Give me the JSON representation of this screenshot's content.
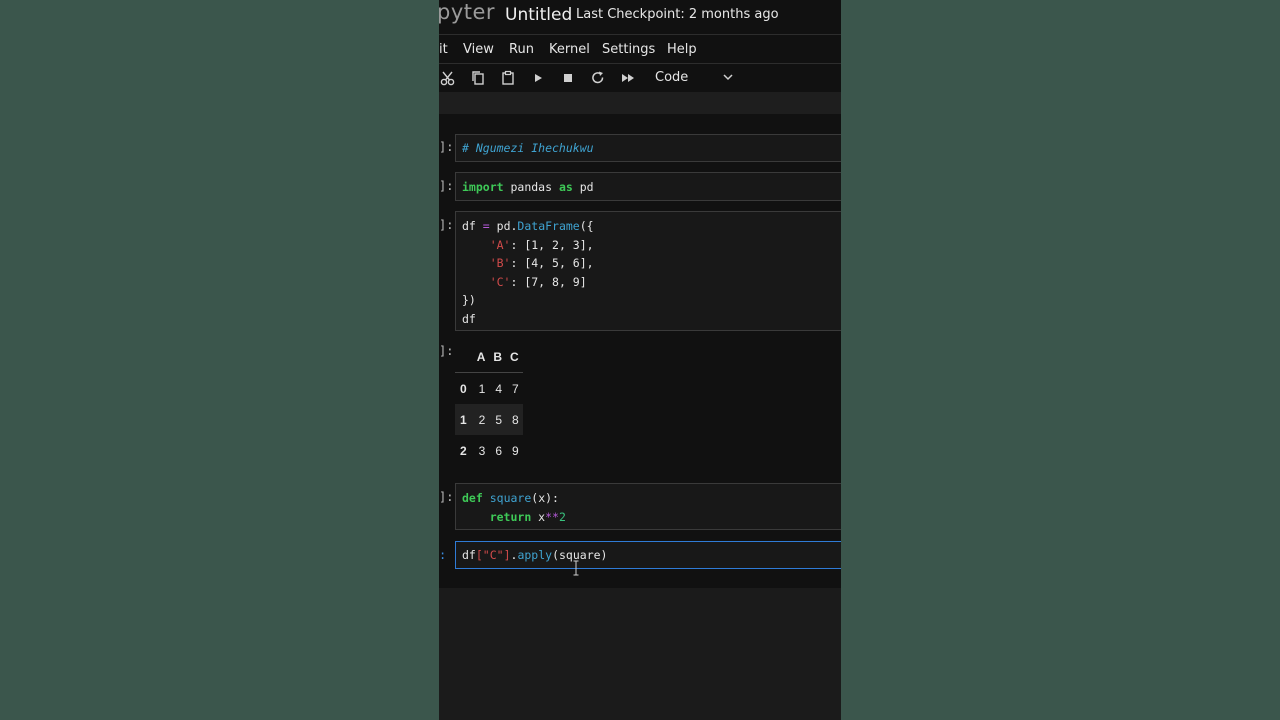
{
  "header": {
    "logo_partial": "pyter",
    "title": "Untitled",
    "checkpoint": "Last Checkpoint: 2 months ago"
  },
  "menu": [
    "it",
    "View",
    "Run",
    "Kernel",
    "Settings",
    "Help"
  ],
  "toolbar": {
    "icons": [
      "cut-icon",
      "copy-icon",
      "paste-icon",
      "run-icon",
      "stop-icon",
      "restart-icon",
      "fast-forward-icon"
    ],
    "cell_type": "Code"
  },
  "cells": {
    "c1": {
      "prompt": "]:",
      "line1": "# Ngumezi Ihechukwu"
    },
    "c2": {
      "prompt": "]:"
    },
    "c3": {
      "prompt": "]:"
    },
    "c3_output": {
      "prompt": "]:"
    },
    "c4": {
      "prompt": "]:"
    },
    "c5": {
      "prompt": ":"
    }
  },
  "dataframe": {
    "columns": [
      "A",
      "B",
      "C"
    ],
    "rows": [
      {
        "index": "0",
        "values": [
          "1",
          "4",
          "7"
        ]
      },
      {
        "index": "1",
        "values": [
          "2",
          "5",
          "8"
        ]
      },
      {
        "index": "2",
        "values": [
          "3",
          "6",
          "9"
        ]
      }
    ]
  },
  "colors": {
    "page_background": "#3b564c",
    "notebook_background": "#111111",
    "keyword": "#3ec957",
    "function": "#3fa3d1",
    "string": "#d24b4b",
    "operator": "#b45ad8",
    "active_border": "#2f7bd6"
  }
}
